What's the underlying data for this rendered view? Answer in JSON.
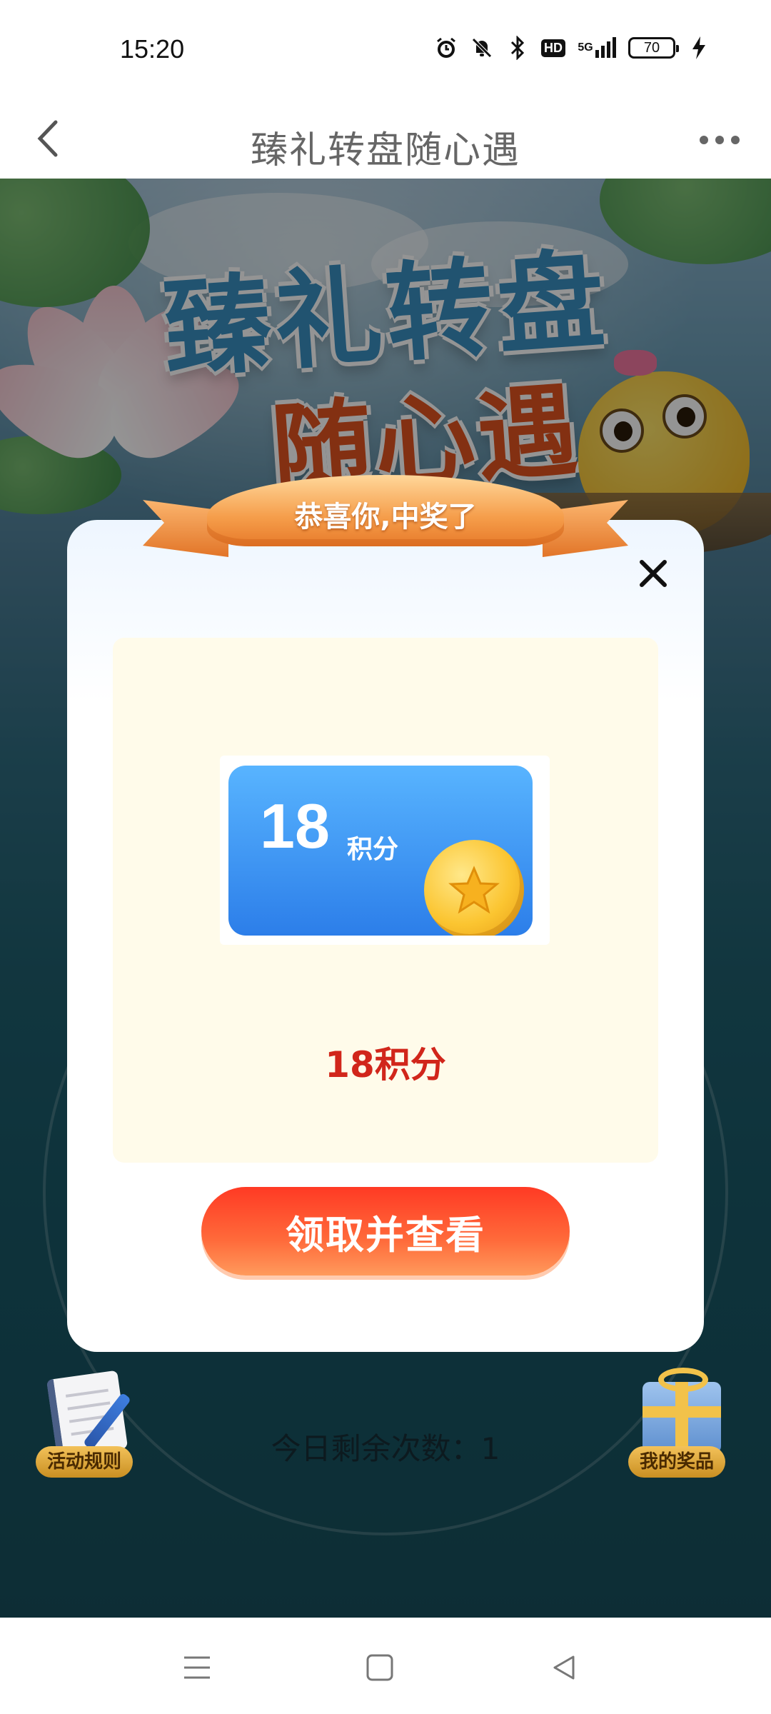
{
  "status_bar": {
    "time": "15:20",
    "network": "5G",
    "hd": "HD",
    "battery": "70",
    "icons": [
      "alarm-icon",
      "mute-icon",
      "bluetooth-icon",
      "hd-icon",
      "signal-icon",
      "battery-icon",
      "charging-icon"
    ]
  },
  "nav": {
    "title": "臻礼转盘随心遇",
    "back_icon": "chevron-left-icon",
    "more_icon": "more-dots-icon"
  },
  "banner": {
    "title": "臻礼转盘",
    "subtitle": "随心遇"
  },
  "modal": {
    "ribbon_text": "恭喜你,中奖了",
    "close_icon": "close-icon",
    "prize_card": {
      "amount": "18",
      "unit": "积分"
    },
    "prize_name": "18积分",
    "claim_button": "领取并查看"
  },
  "bottom": {
    "rules_label": "活动规则",
    "remaining_text": "今日剩余次数：1",
    "prizes_label": "我的奖品"
  },
  "system_nav": {
    "menu_icon": "menu-icon",
    "home_icon": "home-square-icon",
    "back_icon": "back-triangle-icon"
  },
  "colors": {
    "accent_red": "#d1261b",
    "button_gradient_start": "#ff3a24",
    "card_blue": "#2c7ee9",
    "panel_bg": "#fffbea"
  }
}
